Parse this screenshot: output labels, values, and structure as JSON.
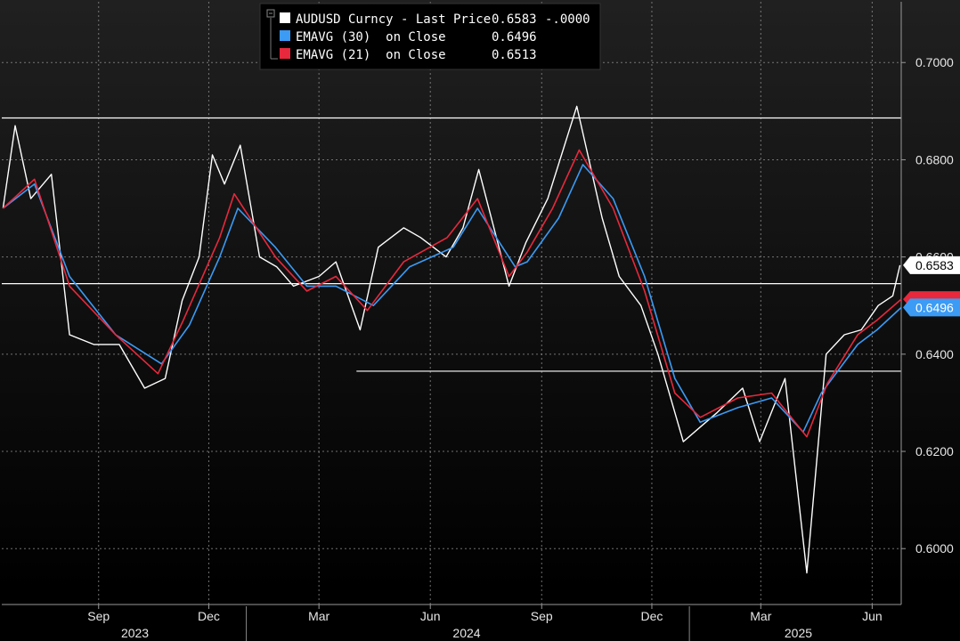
{
  "chart_data": {
    "type": "line",
    "title": "",
    "xlabel": "",
    "ylabel": "",
    "ylim": [
      0.5885,
      0.7125
    ],
    "xlim": [
      "2023-06-13",
      "2025-06-25"
    ],
    "grid": true,
    "legend_position": "top-center",
    "colors": {
      "background_top": "#202020",
      "background_bottom": "#000000",
      "price": "#ffffff",
      "ema30": "#3b9bf5",
      "ema21": "#e8283c",
      "grid": "#8c8c8c"
    },
    "legend": [
      {
        "label": "AUDUSD Curncy - Last Price",
        "value": "0.6583",
        "change": "-.0000",
        "color": "#ffffff"
      },
      {
        "label": "EMAVG (30)  on Close",
        "value": "0.6496",
        "color": "#3b9bf5"
      },
      {
        "label": "EMAVG (21)  on Close",
        "value": "0.6513",
        "color": "#e8283c"
      }
    ],
    "y_ticks": [
      "0.6000",
      "0.6200",
      "0.6400",
      "0.6600",
      "0.6800",
      "0.7000"
    ],
    "x_ticks": [
      {
        "label": "Sep",
        "date": "2023-09-01"
      },
      {
        "label": "Dec",
        "date": "2023-12-01"
      },
      {
        "label": "Mar",
        "date": "2024-03-01"
      },
      {
        "label": "Jun",
        "date": "2024-06-01"
      },
      {
        "label": "Sep",
        "date": "2024-09-01"
      },
      {
        "label": "Dec",
        "date": "2024-12-01"
      },
      {
        "label": "Mar",
        "date": "2025-03-01"
      },
      {
        "label": "Jun",
        "date": "2025-06-01"
      }
    ],
    "year_labels": [
      {
        "label": "2023",
        "date": "2023-10-01"
      },
      {
        "label": "2024",
        "date": "2024-07-01"
      },
      {
        "label": "2025",
        "date": "2025-04-01"
      }
    ],
    "year_dividers": [
      "2024-01-01",
      "2025-01-01"
    ],
    "horizontal_lines": [
      {
        "y": 0.6886,
        "x_start": "2023-06-13",
        "x_end": "2025-06-25"
      },
      {
        "y": 0.6545,
        "x_start": "2023-06-13",
        "x_end": "2025-06-25"
      },
      {
        "y": 0.6365,
        "x_start": "2024-04-01",
        "x_end": "2025-06-25"
      }
    ],
    "value_labels": [
      {
        "text": "0.6583",
        "y": 0.6583,
        "series": "price"
      },
      {
        "text": "0.6496",
        "y": 0.6496,
        "series": "ema30"
      }
    ],
    "series": [
      {
        "name": "AUDUSD Curncy - Last Price",
        "x": [
          "2023-06-14",
          "2023-06-24",
          "2023-07-07",
          "2023-07-24",
          "2023-08-08",
          "2023-08-28",
          "2023-09-18",
          "2023-10-09",
          "2023-10-26",
          "2023-11-09",
          "2023-11-23",
          "2023-12-04",
          "2023-12-14",
          "2023-12-27",
          "2024-01-12",
          "2024-01-26",
          "2024-02-09",
          "2024-03-01",
          "2024-03-15",
          "2024-04-04",
          "2024-04-19",
          "2024-05-10",
          "2024-05-24",
          "2024-06-14",
          "2024-06-28",
          "2024-07-11",
          "2024-08-05",
          "2024-08-19",
          "2024-09-06",
          "2024-09-30",
          "2024-10-21",
          "2024-11-04",
          "2024-11-22",
          "2024-12-06",
          "2024-12-27",
          "2025-01-10",
          "2025-01-24",
          "2025-02-14",
          "2025-02-28",
          "2025-03-21",
          "2025-04-08",
          "2025-04-24",
          "2025-05-09",
          "2025-05-23",
          "2025-06-06",
          "2025-06-18",
          "2025-06-24"
        ],
        "y": [
          0.67,
          0.687,
          0.672,
          0.677,
          0.644,
          0.642,
          0.642,
          0.633,
          0.635,
          0.651,
          0.66,
          0.681,
          0.675,
          0.683,
          0.66,
          0.658,
          0.654,
          0.656,
          0.659,
          0.645,
          0.662,
          0.666,
          0.664,
          0.66,
          0.666,
          0.678,
          0.654,
          0.663,
          0.672,
          0.691,
          0.668,
          0.656,
          0.65,
          0.64,
          0.622,
          0.625,
          0.628,
          0.633,
          0.622,
          0.635,
          0.595,
          0.64,
          0.644,
          0.645,
          0.65,
          0.652,
          0.6583
        ]
      },
      {
        "name": "EMAVG (30)  on Close",
        "x": [
          "2023-06-14",
          "2023-07-10",
          "2023-08-08",
          "2023-09-15",
          "2023-10-23",
          "2023-11-15",
          "2023-12-10",
          "2023-12-25",
          "2024-01-25",
          "2024-02-20",
          "2024-03-15",
          "2024-04-15",
          "2024-05-15",
          "2024-06-20",
          "2024-07-10",
          "2024-08-10",
          "2024-08-20",
          "2024-09-15",
          "2024-10-05",
          "2024-10-30",
          "2024-11-25",
          "2024-12-20",
          "2025-01-10",
          "2025-02-10",
          "2025-03-10",
          "2025-04-05",
          "2025-04-20",
          "2025-05-20",
          "2025-06-05",
          "2025-06-25"
        ],
        "y": [
          0.67,
          0.675,
          0.656,
          0.644,
          0.638,
          0.646,
          0.66,
          0.67,
          0.662,
          0.654,
          0.654,
          0.65,
          0.658,
          0.662,
          0.67,
          0.658,
          0.659,
          0.668,
          0.679,
          0.672,
          0.656,
          0.635,
          0.626,
          0.629,
          0.631,
          0.624,
          0.632,
          0.642,
          0.645,
          0.6496
        ]
      },
      {
        "name": "EMAVG (21)  on Close",
        "x": [
          "2023-06-14",
          "2023-07-10",
          "2023-08-08",
          "2023-09-15",
          "2023-10-20",
          "2023-11-10",
          "2023-12-10",
          "2023-12-22",
          "2024-01-25",
          "2024-02-20",
          "2024-03-15",
          "2024-04-10",
          "2024-05-10",
          "2024-06-15",
          "2024-07-10",
          "2024-08-05",
          "2024-08-20",
          "2024-09-10",
          "2024-10-02",
          "2024-10-30",
          "2024-11-25",
          "2024-12-20",
          "2025-01-10",
          "2025-02-10",
          "2025-03-10",
          "2025-04-08",
          "2025-04-25",
          "2025-05-20",
          "2025-06-05",
          "2025-06-25"
        ],
        "y": [
          0.67,
          0.676,
          0.654,
          0.644,
          0.636,
          0.647,
          0.664,
          0.673,
          0.66,
          0.653,
          0.656,
          0.649,
          0.659,
          0.664,
          0.672,
          0.656,
          0.661,
          0.67,
          0.682,
          0.67,
          0.653,
          0.632,
          0.627,
          0.631,
          0.632,
          0.623,
          0.634,
          0.644,
          0.647,
          0.6513
        ]
      }
    ]
  }
}
